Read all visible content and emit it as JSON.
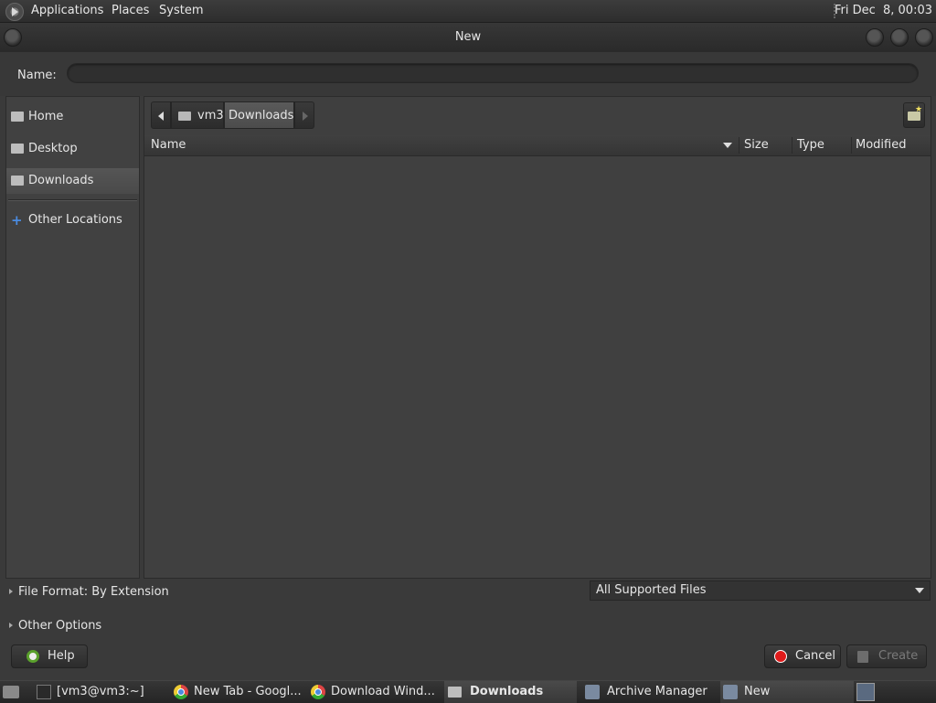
{
  "top_panel": {
    "menus": [
      "Applications",
      "Places",
      "System"
    ],
    "clock": "Fri Dec  8, 00:03"
  },
  "window": {
    "title": "New"
  },
  "name_field": {
    "label": "Name:",
    "value": ""
  },
  "sidebar": {
    "items": [
      {
        "label": "Home",
        "icon": "home-folder-icon"
      },
      {
        "label": "Desktop",
        "icon": "desktop-folder-icon"
      },
      {
        "label": "Downloads",
        "icon": "folder-icon",
        "selected": true
      }
    ],
    "other_locations": "Other Locations"
  },
  "pathbar": {
    "segments": [
      "vm3",
      "Downloads"
    ]
  },
  "columns": {
    "name": "Name",
    "size": "Size",
    "type": "Type",
    "modified": "Modified"
  },
  "file_format": {
    "label": "File Format: By Extension"
  },
  "filter": {
    "selected": "All Supported Files"
  },
  "other_options": {
    "label": "Other Options"
  },
  "buttons": {
    "help": "Help",
    "cancel": "Cancel",
    "create": "Create"
  },
  "taskbar": {
    "tasks": [
      {
        "label": "[vm3@vm3:~]",
        "icon": "terminal-icon"
      },
      {
        "label": "New Tab - Googl...",
        "icon": "chrome-icon"
      },
      {
        "label": "Download Wind...",
        "icon": "chrome-icon"
      },
      {
        "label": "Downloads",
        "icon": "folder-icon",
        "active": true
      },
      {
        "label": "Archive Manager",
        "icon": "archive-icon"
      },
      {
        "label": "New",
        "icon": "document-icon"
      }
    ]
  },
  "colors": {
    "accent_red": "#e01b1b",
    "help_green": "#5aa02c",
    "other_locations_blue": "#4a8be0"
  }
}
